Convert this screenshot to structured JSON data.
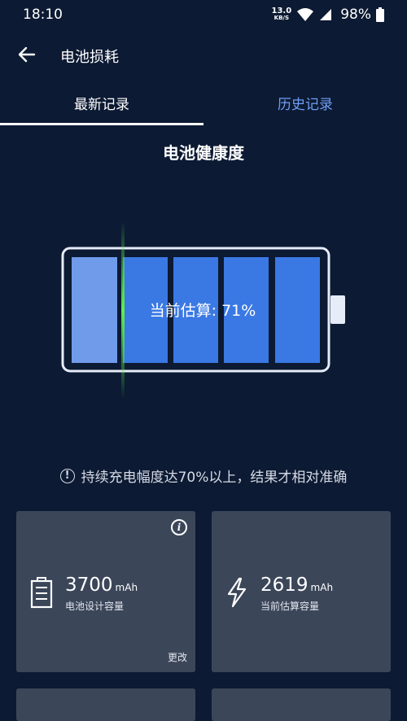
{
  "status_bar": {
    "time": "18:10",
    "net_speed_value": "13.0",
    "net_speed_unit": "KB/S",
    "battery_percent": "98%"
  },
  "app_bar": {
    "title": "电池损耗",
    "back_icon": "arrow-left-icon"
  },
  "tabs": [
    {
      "label": "最新记录",
      "active": true
    },
    {
      "label": "历史记录",
      "active": false
    }
  ],
  "health": {
    "section_title": "电池健康度",
    "estimate_text": "当前估算: 71%",
    "estimate_percent": 71
  },
  "hint": {
    "icon": "exclamation-circle-icon",
    "text": "持续充电幅度达70%以上，结果才相对准确"
  },
  "cards": {
    "design_capacity": {
      "value": "3700",
      "unit": "mAh",
      "label": "电池设计容量",
      "action": "更改",
      "icon": "battery-icon",
      "info_icon": "info-icon"
    },
    "estimated_capacity": {
      "value": "2619",
      "unit": "mAh",
      "label": "当前估算容量",
      "icon": "lightning-icon"
    }
  },
  "colors": {
    "background": "#0c1a33",
    "accent": "#6f9ef5",
    "cell_blue": "#3a78e4",
    "cell_light": "#6f9bea",
    "card_bg": "#3b4659",
    "scan_line": "#5ef04a"
  }
}
